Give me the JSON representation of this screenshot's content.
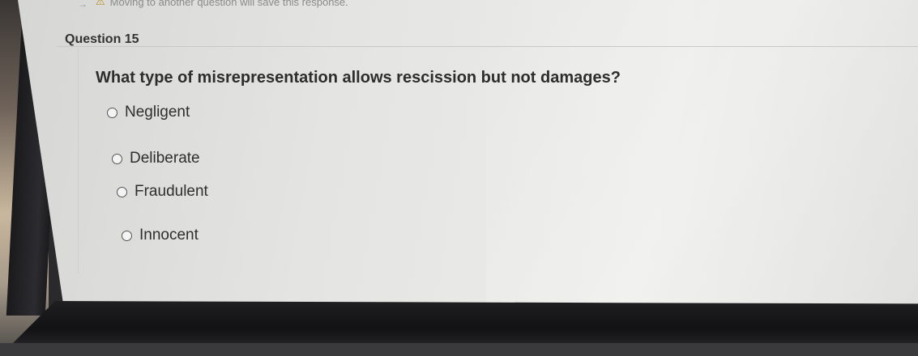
{
  "warning": {
    "text": "Moving to another question will save this response."
  },
  "question": {
    "header": "Question 15",
    "text": "What type of misrepresentation allows rescission but not damages?",
    "options": [
      {
        "label": "Negligent",
        "selected": false
      },
      {
        "label": "Deliberate",
        "selected": false
      },
      {
        "label": "Fraudulent",
        "selected": false
      },
      {
        "label": "Innocent",
        "selected": false
      }
    ]
  }
}
